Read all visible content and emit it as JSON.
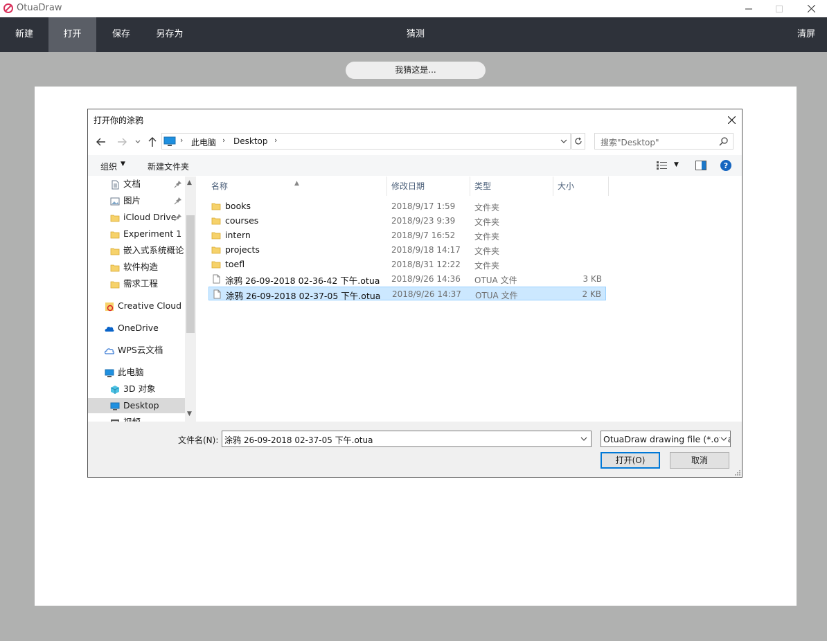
{
  "app": {
    "title": "OtuaDraw",
    "brand_color": "#d8315b"
  },
  "toolbar": {
    "new": "新建",
    "open": "打开",
    "save": "保存",
    "save_as": "另存为",
    "guess": "猜测",
    "clear": "清屏",
    "bg_color": "#2e323a",
    "active_color": "#5a5e66"
  },
  "guess_result": "我猜这是...",
  "dialog": {
    "title": "打开你的涂鸦",
    "address": {
      "crumbs": [
        "此电脑",
        "Desktop"
      ]
    },
    "search_placeholder": "搜索\"Desktop\"",
    "commands": {
      "organize": "组织",
      "new_folder": "新建文件夹"
    },
    "nav_items": [
      {
        "label": "文档",
        "icon": "document-icon",
        "pinned": true
      },
      {
        "label": "图片",
        "icon": "picture-icon",
        "pinned": true
      },
      {
        "label": "iCloud Drive",
        "icon": "folder-icon",
        "pinned": true
      },
      {
        "label": "Experiment 1",
        "icon": "folder-icon"
      },
      {
        "label": "嵌入式系统概论",
        "icon": "folder-icon"
      },
      {
        "label": "软件构造",
        "icon": "folder-icon"
      },
      {
        "label": "需求工程",
        "icon": "folder-icon"
      },
      {
        "label": "Creative Cloud F",
        "icon": "creative-cloud-icon"
      },
      {
        "label": "OneDrive",
        "icon": "onedrive-icon"
      },
      {
        "label": "WPS云文档",
        "icon": "cloud-icon"
      },
      {
        "label": "此电脑",
        "icon": "pc-icon"
      },
      {
        "label": "3D 对象",
        "icon": "cube-icon"
      },
      {
        "label": "Desktop",
        "icon": "desktop-icon",
        "selected": true
      },
      {
        "label": "视频",
        "icon": "video-icon"
      }
    ],
    "columns": {
      "name": "名称",
      "modified": "修改日期",
      "type": "类型",
      "size": "大小"
    },
    "files": [
      {
        "name": "books",
        "modified": "2018/9/17 1:59",
        "type": "文件夹",
        "size": "",
        "kind": "folder"
      },
      {
        "name": "courses",
        "modified": "2018/9/23 9:39",
        "type": "文件夹",
        "size": "",
        "kind": "folder"
      },
      {
        "name": "intern",
        "modified": "2018/9/7 16:52",
        "type": "文件夹",
        "size": "",
        "kind": "folder"
      },
      {
        "name": "projects",
        "modified": "2018/9/18 14:17",
        "type": "文件夹",
        "size": "",
        "kind": "folder"
      },
      {
        "name": "toefl",
        "modified": "2018/8/31 12:22",
        "type": "文件夹",
        "size": "",
        "kind": "folder"
      },
      {
        "name": "涂鸦 26-09-2018 02-36-42 下午.otua",
        "modified": "2018/9/26 14:36",
        "type": "OTUA 文件",
        "size": "3 KB",
        "kind": "file"
      },
      {
        "name": "涂鸦 26-09-2018 02-37-05 下午.otua",
        "modified": "2018/9/26 14:37",
        "type": "OTUA 文件",
        "size": "2 KB",
        "kind": "file",
        "selected": true
      }
    ],
    "filename_label": "文件名(N):",
    "filename_value": "涂鸦 26-09-2018 02-37-05 下午.otua",
    "filetype_value": "OtuaDraw drawing file (*.otua)",
    "open_button": "打开(O)",
    "cancel_button": "取消"
  }
}
